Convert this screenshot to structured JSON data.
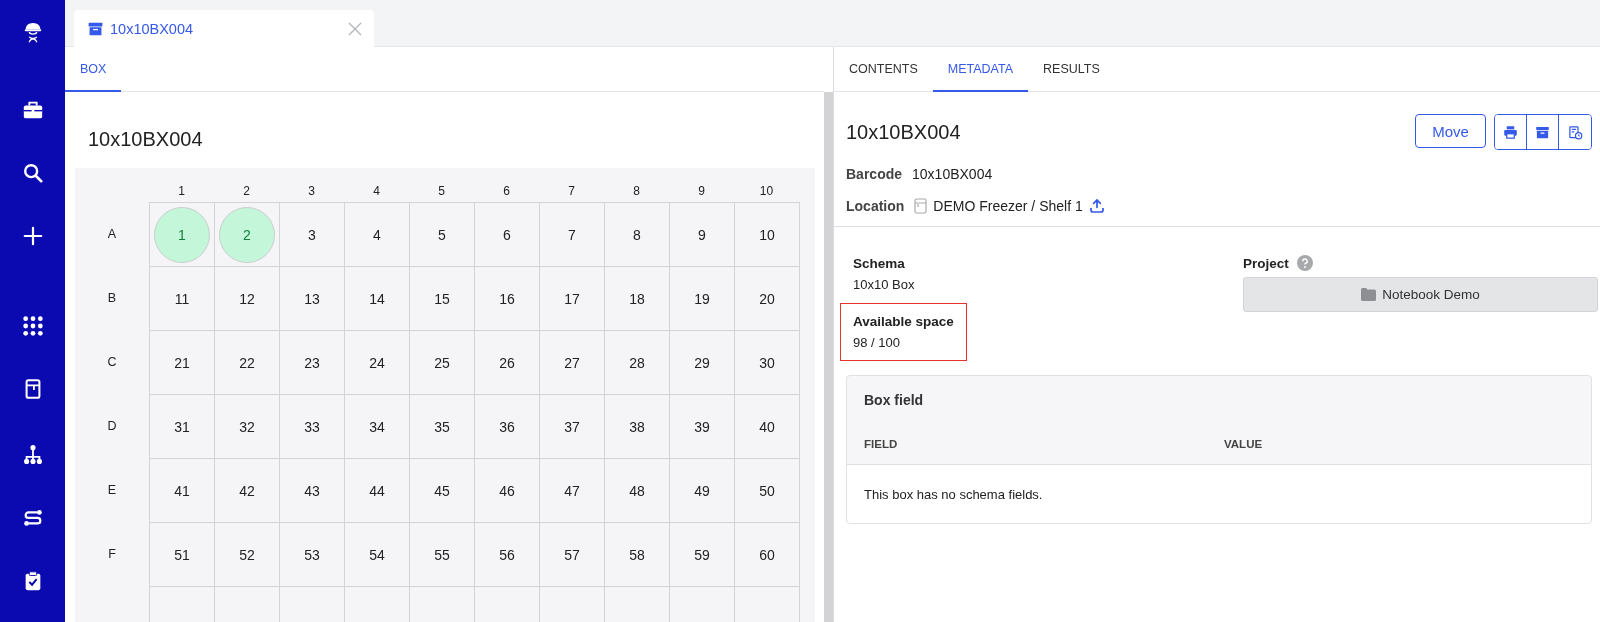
{
  "document_tab": {
    "title": "10x10BX004",
    "selected": true
  },
  "left_pane": {
    "tabs": [
      {
        "label": "BOX",
        "selected": true
      }
    ],
    "title": "10x10BX004",
    "grid": {
      "columns": [
        "1",
        "2",
        "3",
        "4",
        "5",
        "6",
        "7",
        "8",
        "9",
        "10"
      ],
      "rows": [
        {
          "label": "A",
          "cells": [
            {
              "text": "1",
              "filled": true
            },
            {
              "text": "2",
              "filled": true
            },
            {
              "text": "3",
              "filled": false
            },
            {
              "text": "4",
              "filled": false
            },
            {
              "text": "5",
              "filled": false
            },
            {
              "text": "6",
              "filled": false
            },
            {
              "text": "7",
              "filled": false
            },
            {
              "text": "8",
              "filled": false
            },
            {
              "text": "9",
              "filled": false
            },
            {
              "text": "10",
              "filled": false
            }
          ]
        },
        {
          "label": "B",
          "cells": [
            {
              "text": "11",
              "filled": false
            },
            {
              "text": "12",
              "filled": false
            },
            {
              "text": "13",
              "filled": false
            },
            {
              "text": "14",
              "filled": false
            },
            {
              "text": "15",
              "filled": false
            },
            {
              "text": "16",
              "filled": false
            },
            {
              "text": "17",
              "filled": false
            },
            {
              "text": "18",
              "filled": false
            },
            {
              "text": "19",
              "filled": false
            },
            {
              "text": "20",
              "filled": false
            }
          ]
        },
        {
          "label": "C",
          "cells": [
            {
              "text": "21",
              "filled": false
            },
            {
              "text": "22",
              "filled": false
            },
            {
              "text": "23",
              "filled": false
            },
            {
              "text": "24",
              "filled": false
            },
            {
              "text": "25",
              "filled": false
            },
            {
              "text": "26",
              "filled": false
            },
            {
              "text": "27",
              "filled": false
            },
            {
              "text": "28",
              "filled": false
            },
            {
              "text": "29",
              "filled": false
            },
            {
              "text": "30",
              "filled": false
            }
          ]
        },
        {
          "label": "D",
          "cells": [
            {
              "text": "31",
              "filled": false
            },
            {
              "text": "32",
              "filled": false
            },
            {
              "text": "33",
              "filled": false
            },
            {
              "text": "34",
              "filled": false
            },
            {
              "text": "35",
              "filled": false
            },
            {
              "text": "36",
              "filled": false
            },
            {
              "text": "37",
              "filled": false
            },
            {
              "text": "38",
              "filled": false
            },
            {
              "text": "39",
              "filled": false
            },
            {
              "text": "40",
              "filled": false
            }
          ]
        },
        {
          "label": "E",
          "cells": [
            {
              "text": "41",
              "filled": false
            },
            {
              "text": "42",
              "filled": false
            },
            {
              "text": "43",
              "filled": false
            },
            {
              "text": "44",
              "filled": false
            },
            {
              "text": "45",
              "filled": false
            },
            {
              "text": "46",
              "filled": false
            },
            {
              "text": "47",
              "filled": false
            },
            {
              "text": "48",
              "filled": false
            },
            {
              "text": "49",
              "filled": false
            },
            {
              "text": "50",
              "filled": false
            }
          ]
        },
        {
          "label": "F",
          "cells": [
            {
              "text": "51",
              "filled": false
            },
            {
              "text": "52",
              "filled": false
            },
            {
              "text": "53",
              "filled": false
            },
            {
              "text": "54",
              "filled": false
            },
            {
              "text": "55",
              "filled": false
            },
            {
              "text": "56",
              "filled": false
            },
            {
              "text": "57",
              "filled": false
            },
            {
              "text": "58",
              "filled": false
            },
            {
              "text": "59",
              "filled": false
            },
            {
              "text": "60",
              "filled": false
            }
          ]
        }
      ]
    }
  },
  "right_pane": {
    "tabs": [
      {
        "label": "CONTENTS",
        "selected": false
      },
      {
        "label": "METADATA",
        "selected": true
      },
      {
        "label": "RESULTS",
        "selected": false
      }
    ],
    "title": "10x10BX004",
    "move_button": "Move",
    "barcode": {
      "label": "Barcode",
      "value": "10x10BX004"
    },
    "location": {
      "label": "Location",
      "value": "DEMO Freezer / Shelf 1"
    },
    "fields": [
      {
        "label": "Schema",
        "value": "10x10 Box",
        "highlighted": false
      },
      {
        "label": "Available space",
        "value": "98 / 100",
        "highlighted": true
      }
    ],
    "project": {
      "label": "Project",
      "value": "Notebook Demo"
    },
    "box_field": {
      "title": "Box field",
      "columns": [
        "FIELD",
        "VALUE"
      ],
      "empty_message": "This box has no schema fields."
    }
  }
}
